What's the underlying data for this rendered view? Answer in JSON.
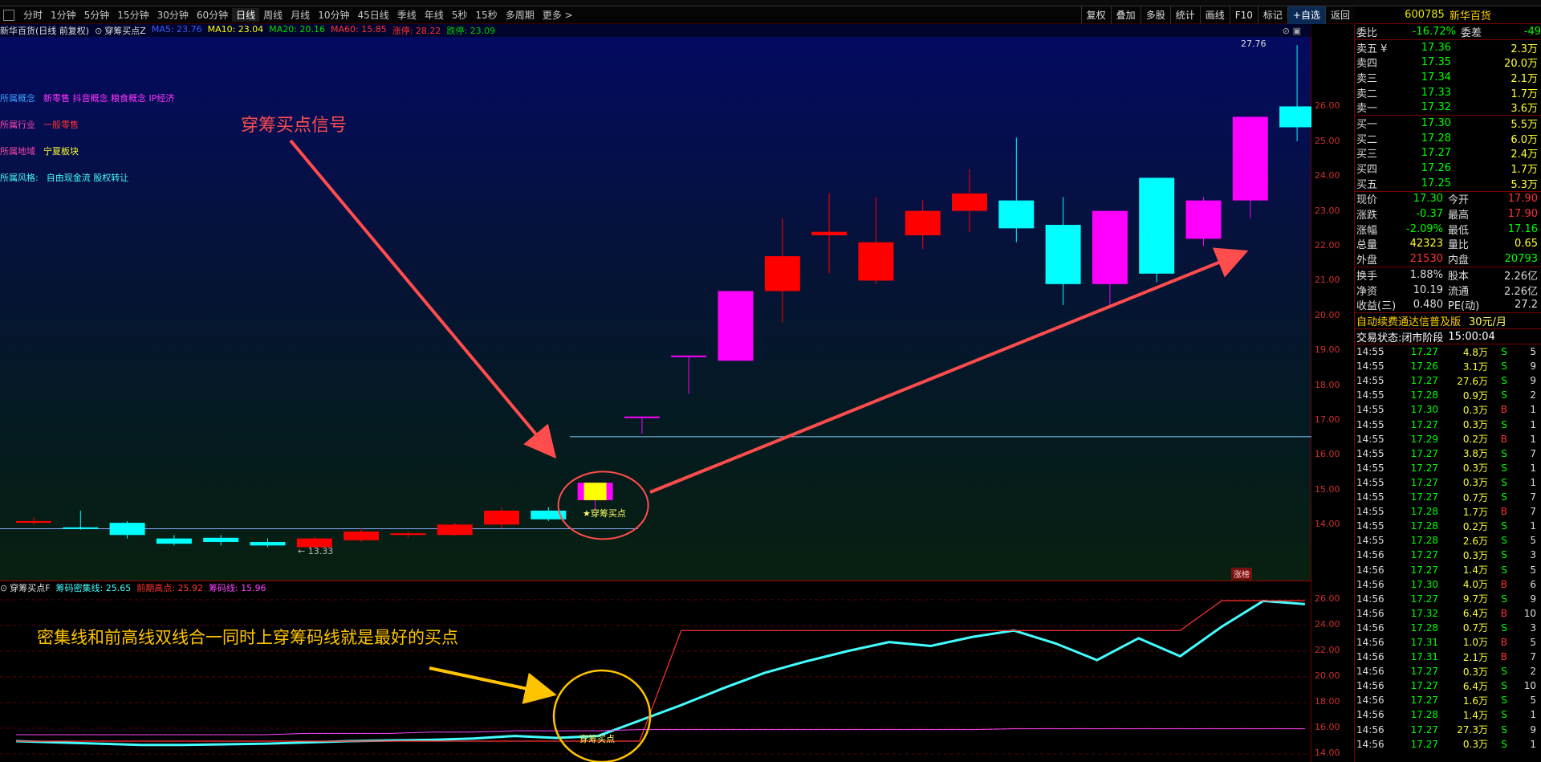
{
  "toolbar": {
    "periods": [
      "分时",
      "1分钟",
      "5分钟",
      "15分钟",
      "30分钟",
      "60分钟",
      "日线",
      "周线",
      "月线",
      "10分钟",
      "45日线",
      "季线",
      "年线",
      "5秒",
      "15秒",
      "多周期",
      "更多 >"
    ],
    "active_period": "日线",
    "right_buttons": [
      "复权",
      "叠加",
      "多股",
      "统计",
      "画线",
      "F10",
      "标记",
      "+自选",
      "返回"
    ]
  },
  "main_chart": {
    "stock_title": "新华百货(日线 前复权)",
    "indicator_name": "穿筹买点Z",
    "ma_labels": [
      {
        "text": "MA5: 23.76",
        "color": "#3a5cff"
      },
      {
        "text": "MA10: 23.04",
        "color": "#ffff00"
      },
      {
        "text": "MA20: 20.16",
        "color": "#00e000"
      },
      {
        "text": "MA60: 15.85",
        "color": "#ff3333"
      },
      {
        "text": "涨停: 28.22",
        "color": "#ff3333"
      },
      {
        "text": "跌停: 23.09",
        "color": "#00cc00"
      }
    ],
    "concepts": [
      {
        "key": "所属概念",
        "value": "新零售 抖音概念 粮食概念 IP经济",
        "key_color": "#3aa0ff",
        "value_color": "#ff33ff"
      },
      {
        "key": "所属行业",
        "value": "一般零售",
        "key_color": "#ff44aa",
        "value_color": "#ff3333"
      },
      {
        "key": "所属地域",
        "value": "宁夏板块",
        "key_color": "#ff44aa",
        "value_color": "#ffff33"
      },
      {
        "key": "所属风格:",
        "value": "自由现金流 股权转让",
        "key_color": "#44ffff",
        "value_color": "#44ffff"
      }
    ],
    "annotation_signal": "穿筹买点信号",
    "signal_label": "★穿筹买点",
    "high_label": "27.76",
    "low_label": "13.33",
    "limit_badge": "涨榜",
    "price_ticks": [
      "26.00",
      "25.00",
      "24.00",
      "23.00",
      "22.00",
      "21.00",
      "20.00",
      "19.00",
      "18.00",
      "17.00",
      "16.00",
      "15.00",
      "14.00"
    ]
  },
  "chart_data": {
    "type": "candlestick",
    "title": "新华百货(日线 前复权)",
    "ylim": [
      13.2,
      27.9
    ],
    "candles": [
      {
        "o": 14.1,
        "h": 14.2,
        "l": 14.0,
        "c": 14.05,
        "color": "#ff0000"
      },
      {
        "o": 13.9,
        "h": 14.4,
        "l": 13.85,
        "c": 13.92,
        "color": "#00ffff"
      },
      {
        "o": 14.05,
        "h": 14.1,
        "l": 13.6,
        "c": 13.7,
        "color": "#00ffff"
      },
      {
        "o": 13.6,
        "h": 13.7,
        "l": 13.4,
        "c": 13.45,
        "color": "#00ffff"
      },
      {
        "o": 13.62,
        "h": 13.7,
        "l": 13.4,
        "c": 13.5,
        "color": "#00ffff"
      },
      {
        "o": 13.5,
        "h": 13.6,
        "l": 13.35,
        "c": 13.4,
        "color": "#00ffff"
      },
      {
        "o": 13.35,
        "h": 13.65,
        "l": 13.33,
        "c": 13.6,
        "color": "#ff0000"
      },
      {
        "o": 13.55,
        "h": 13.9,
        "l": 13.5,
        "c": 13.8,
        "color": "#ff0000"
      },
      {
        "o": 13.7,
        "h": 13.8,
        "l": 13.62,
        "c": 13.75,
        "color": "#ff0000"
      },
      {
        "o": 13.7,
        "h": 14.05,
        "l": 13.68,
        "c": 14.0,
        "color": "#ff0000"
      },
      {
        "o": 14.0,
        "h": 14.5,
        "l": 13.9,
        "c": 14.4,
        "color": "#ff0000"
      },
      {
        "o": 14.15,
        "h": 14.5,
        "l": 14.1,
        "c": 14.4,
        "color": "#00ffff"
      },
      {
        "o": 14.7,
        "h": 15.2,
        "l": 14.4,
        "c": 15.2,
        "color": "#ff00ff"
      },
      {
        "o": 17.1,
        "h": 17.1,
        "l": 16.6,
        "c": 17.1,
        "color": "#ff00ff"
      },
      {
        "o": 18.85,
        "h": 18.85,
        "l": 17.75,
        "c": 18.85,
        "color": "#ff00ff"
      },
      {
        "o": 18.7,
        "h": 20.7,
        "l": 18.7,
        "c": 20.7,
        "color": "#ff00ff"
      },
      {
        "o": 20.7,
        "h": 22.8,
        "l": 19.8,
        "c": 21.7,
        "color": "#ff0000"
      },
      {
        "o": 22.3,
        "h": 23.5,
        "l": 21.2,
        "c": 22.4,
        "color": "#ff0000"
      },
      {
        "o": 21.0,
        "h": 23.4,
        "l": 20.9,
        "c": 22.1,
        "color": "#ff0000"
      },
      {
        "o": 22.3,
        "h": 23.3,
        "l": 21.9,
        "c": 23.0,
        "color": "#ff0000"
      },
      {
        "o": 23.0,
        "h": 24.2,
        "l": 22.4,
        "c": 23.5,
        "color": "#ff0000"
      },
      {
        "o": 23.3,
        "h": 25.1,
        "l": 22.1,
        "c": 22.5,
        "color": "#00ffff"
      },
      {
        "o": 22.6,
        "h": 23.4,
        "l": 20.3,
        "c": 20.9,
        "color": "#00ffff"
      },
      {
        "o": 23.0,
        "h": 23.0,
        "l": 20.3,
        "c": 20.9,
        "color": "#ff00ff"
      },
      {
        "o": 23.95,
        "h": 23.95,
        "l": 20.95,
        "c": 21.2,
        "color": "#00ffff"
      },
      {
        "o": 22.2,
        "h": 23.4,
        "l": 22.0,
        "c": 23.3,
        "color": "#ff00ff"
      },
      {
        "o": 23.3,
        "h": 25.7,
        "l": 22.8,
        "c": 25.7,
        "color": "#ff00ff"
      },
      {
        "o": 26.0,
        "h": 27.76,
        "l": 25.0,
        "c": 25.4,
        "color": "#00ffff"
      }
    ],
    "sub_series": [
      {
        "name": "筹码密集线",
        "values": [
          15.0,
          14.9,
          14.8,
          14.7,
          14.7,
          14.75,
          14.8,
          14.9,
          15.0,
          15.05,
          15.1,
          15.2,
          15.4,
          15.25,
          15.4,
          16.6,
          17.8,
          19.1,
          20.3,
          21.2,
          22.0,
          22.7,
          22.4,
          23.1,
          23.6,
          22.6,
          21.3,
          23.0,
          21.6,
          23.9,
          25.9,
          25.65
        ]
      },
      {
        "name": "前期高点",
        "values": [
          15.0,
          15.0,
          15.0,
          15.0,
          15.0,
          15.0,
          15.0,
          15.0,
          15.0,
          15.0,
          15.0,
          15.0,
          15.0,
          15.0,
          15.0,
          15.0,
          23.6,
          23.6,
          23.6,
          23.6,
          23.6,
          23.6,
          23.6,
          23.6,
          23.6,
          23.6,
          23.6,
          23.6,
          23.6,
          25.92,
          25.92,
          25.92
        ]
      },
      {
        "name": "筹码线",
        "values": [
          15.5,
          15.5,
          15.5,
          15.5,
          15.5,
          15.5,
          15.5,
          15.6,
          15.6,
          15.6,
          15.7,
          15.7,
          15.8,
          15.8,
          15.8,
          15.9,
          15.9,
          15.9,
          15.9,
          15.9,
          15.9,
          15.9,
          15.9,
          15.9,
          15.96,
          15.96,
          15.96,
          15.96,
          15.96,
          15.96,
          15.96,
          15.96
        ]
      }
    ],
    "sub_ylim": [
      14.0,
      26.8
    ]
  },
  "sub_chart": {
    "title": "穿筹买点F",
    "values": [
      {
        "text": "筹码密集线: 25.65",
        "color": "#44ffff"
      },
      {
        "text": "前期高点: 25.92",
        "color": "#ff3333"
      },
      {
        "text": "筹码线: 15.96",
        "color": "#ff44ff"
      }
    ],
    "annotation_text": "密集线和前高线双线合一同时上穿筹码线就是最好的买点",
    "buy_label": "穿筹买点",
    "ticks": [
      "26.00",
      "24.00",
      "22.00",
      "20.00",
      "18.00",
      "16.00",
      "14.00"
    ]
  },
  "right_panel": {
    "code": "600785",
    "name": "新华百货",
    "weibi": {
      "label": "委比",
      "value": "-16.72%",
      "label2": "委差",
      "value2": "-49"
    },
    "asks": [
      {
        "label": "卖五 ¥",
        "price": "17.36",
        "vol": "2.3万"
      },
      {
        "label": "卖四",
        "price": "17.35",
        "vol": "20.0万"
      },
      {
        "label": "卖三",
        "price": "17.34",
        "vol": "2.1万"
      },
      {
        "label": "卖二",
        "price": "17.33",
        "vol": "1.7万"
      },
      {
        "label": "卖一",
        "price": "17.32",
        "vol": "3.6万"
      }
    ],
    "bids": [
      {
        "label": "买一",
        "price": "17.30",
        "vol": "5.5万"
      },
      {
        "label": "买二",
        "price": "17.28",
        "vol": "6.0万"
      },
      {
        "label": "买三",
        "price": "17.27",
        "vol": "2.4万"
      },
      {
        "label": "买四",
        "price": "17.26",
        "vol": "1.7万"
      },
      {
        "label": "买五",
        "price": "17.25",
        "vol": "5.3万"
      }
    ],
    "stats": [
      {
        "k1": "现价",
        "v1": "17.30",
        "c1": "#00ff00",
        "k2": "今开",
        "v2": "17.90",
        "c2": "#ff3333"
      },
      {
        "k1": "涨跌",
        "v1": "-0.37",
        "c1": "#00ff00",
        "k2": "最高",
        "v2": "17.90",
        "c2": "#ff3333"
      },
      {
        "k1": "涨幅",
        "v1": "-2.09%",
        "c1": "#00ff00",
        "k2": "最低",
        "v2": "17.16",
        "c2": "#00ff00"
      },
      {
        "k1": "总量",
        "v1": "42323",
        "c1": "#ffff33",
        "k2": "量比",
        "v2": "0.65",
        "c2": "#ffff33"
      },
      {
        "k1": "外盘",
        "v1": "21530",
        "c1": "#ff3333",
        "k2": "内盘",
        "v2": "20793",
        "c2": "#00ff00"
      }
    ],
    "stats2": [
      {
        "k1": "换手",
        "v1": "1.88%",
        "k2": "股本",
        "v2": "2.26亿"
      },
      {
        "k1": "净资",
        "v1": "10.19",
        "k2": "流通",
        "v2": "2.26亿"
      },
      {
        "k1": "收益(三)",
        "v1": "0.480",
        "k2": "PE(动)",
        "v2": "27.2"
      }
    ],
    "banner": "自动续费通达信普及版",
    "banner_price": "30元/月",
    "status_label": "交易状态:",
    "status_value": "闭市阶段",
    "status_time": "15:00:04",
    "ticks": [
      {
        "t": "14:55",
        "p": "17.27",
        "v": "4.8万",
        "d": "S",
        "n": "5"
      },
      {
        "t": "14:55",
        "p": "17.26",
        "v": "3.1万",
        "d": "S",
        "n": "9"
      },
      {
        "t": "14:55",
        "p": "17.27",
        "v": "27.6万",
        "d": "S",
        "n": "9"
      },
      {
        "t": "14:55",
        "p": "17.28",
        "v": "0.9万",
        "d": "S",
        "n": "2"
      },
      {
        "t": "14:55",
        "p": "17.30",
        "v": "0.3万",
        "d": "B",
        "n": "1"
      },
      {
        "t": "14:55",
        "p": "17.27",
        "v": "0.3万",
        "d": "S",
        "n": "1"
      },
      {
        "t": "14:55",
        "p": "17.29",
        "v": "0.2万",
        "d": "B",
        "n": "1"
      },
      {
        "t": "14:55",
        "p": "17.27",
        "v": "3.8万",
        "d": "S",
        "n": "7"
      },
      {
        "t": "14:55",
        "p": "17.27",
        "v": "0.3万",
        "d": "S",
        "n": "1"
      },
      {
        "t": "14:55",
        "p": "17.27",
        "v": "0.3万",
        "d": "S",
        "n": "1"
      },
      {
        "t": "14:55",
        "p": "17.27",
        "v": "0.7万",
        "d": "S",
        "n": "7"
      },
      {
        "t": "14:55",
        "p": "17.28",
        "v": "1.7万",
        "d": "B",
        "n": "7"
      },
      {
        "t": "14:55",
        "p": "17.28",
        "v": "0.2万",
        "d": "S",
        "n": "1"
      },
      {
        "t": "14:55",
        "p": "17.28",
        "v": "2.6万",
        "d": "S",
        "n": "5"
      },
      {
        "t": "14:56",
        "p": "17.27",
        "v": "0.3万",
        "d": "S",
        "n": "3"
      },
      {
        "t": "14:56",
        "p": "17.27",
        "v": "1.4万",
        "d": "S",
        "n": "5"
      },
      {
        "t": "14:56",
        "p": "17.30",
        "v": "4.0万",
        "d": "B",
        "n": "6"
      },
      {
        "t": "14:56",
        "p": "17.27",
        "v": "9.7万",
        "d": "S",
        "n": "9"
      },
      {
        "t": "14:56",
        "p": "17.32",
        "v": "6.4万",
        "d": "B",
        "n": "10"
      },
      {
        "t": "14:56",
        "p": "17.28",
        "v": "0.7万",
        "d": "S",
        "n": "3"
      },
      {
        "t": "14:56",
        "p": "17.31",
        "v": "1.0万",
        "d": "B",
        "n": "5"
      },
      {
        "t": "14:56",
        "p": "17.31",
        "v": "2.1万",
        "d": "B",
        "n": "7"
      },
      {
        "t": "14:56",
        "p": "17.27",
        "v": "0.3万",
        "d": "S",
        "n": "2"
      },
      {
        "t": "14:56",
        "p": "17.27",
        "v": "6.4万",
        "d": "S",
        "n": "10"
      },
      {
        "t": "14:56",
        "p": "17.27",
        "v": "1.6万",
        "d": "S",
        "n": "5"
      },
      {
        "t": "14:56",
        "p": "17.28",
        "v": "1.4万",
        "d": "S",
        "n": "1"
      },
      {
        "t": "14:56",
        "p": "17.27",
        "v": "27.3万",
        "d": "S",
        "n": "9"
      },
      {
        "t": "14:56",
        "p": "17.27",
        "v": "0.3万",
        "d": "S",
        "n": "1"
      }
    ]
  }
}
